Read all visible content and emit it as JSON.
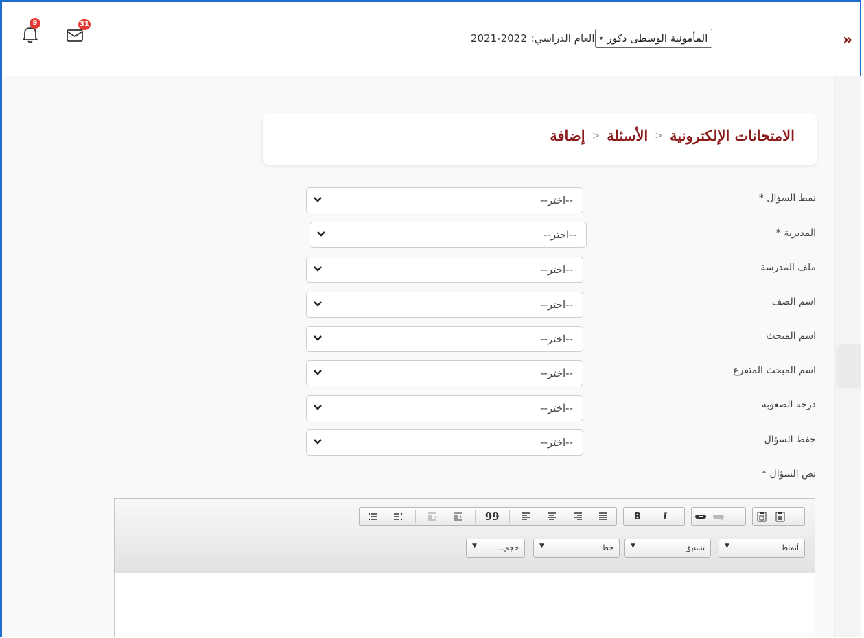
{
  "header": {
    "collapse_icon": "double-chevron-right",
    "year_label": "العام الدراسي:",
    "year_value": "2021-2022",
    "school_selected": "المأمونية الوسطى ذكور",
    "notifications_count": "9",
    "messages_count": "31"
  },
  "breadcrumb": {
    "items": [
      "الامتحانات الإلكترونية",
      "الأسئلة",
      "إضافة"
    ]
  },
  "form": {
    "placeholder": "--اختر--",
    "fields": [
      {
        "label": "نمط السؤال *",
        "value": "--اختر--"
      },
      {
        "label": "المديرية *",
        "value": "--اختر--"
      },
      {
        "label": "ملف المدرسة",
        "value": "--اختر--"
      },
      {
        "label": "اسم الصف",
        "value": "--اختر--"
      },
      {
        "label": "اسم المبحث",
        "value": "--اختر--"
      },
      {
        "label": "اسم المبحث المتفرع",
        "value": "--اختر--"
      },
      {
        "label": "درجة الصعوبة",
        "value": "--اختر--"
      },
      {
        "label": "حفظ السؤال",
        "value": "--اختر--"
      }
    ],
    "question_text_label": "نص السؤال *"
  },
  "editor": {
    "bold": "B",
    "italic": "I",
    "quote": "99",
    "combos": [
      "أنماط",
      "تنسيق",
      "خط",
      "حجم..."
    ]
  },
  "colors": {
    "accent": "#8b1a1a",
    "frame": "#1f6fd1",
    "badge": "#e53935"
  }
}
